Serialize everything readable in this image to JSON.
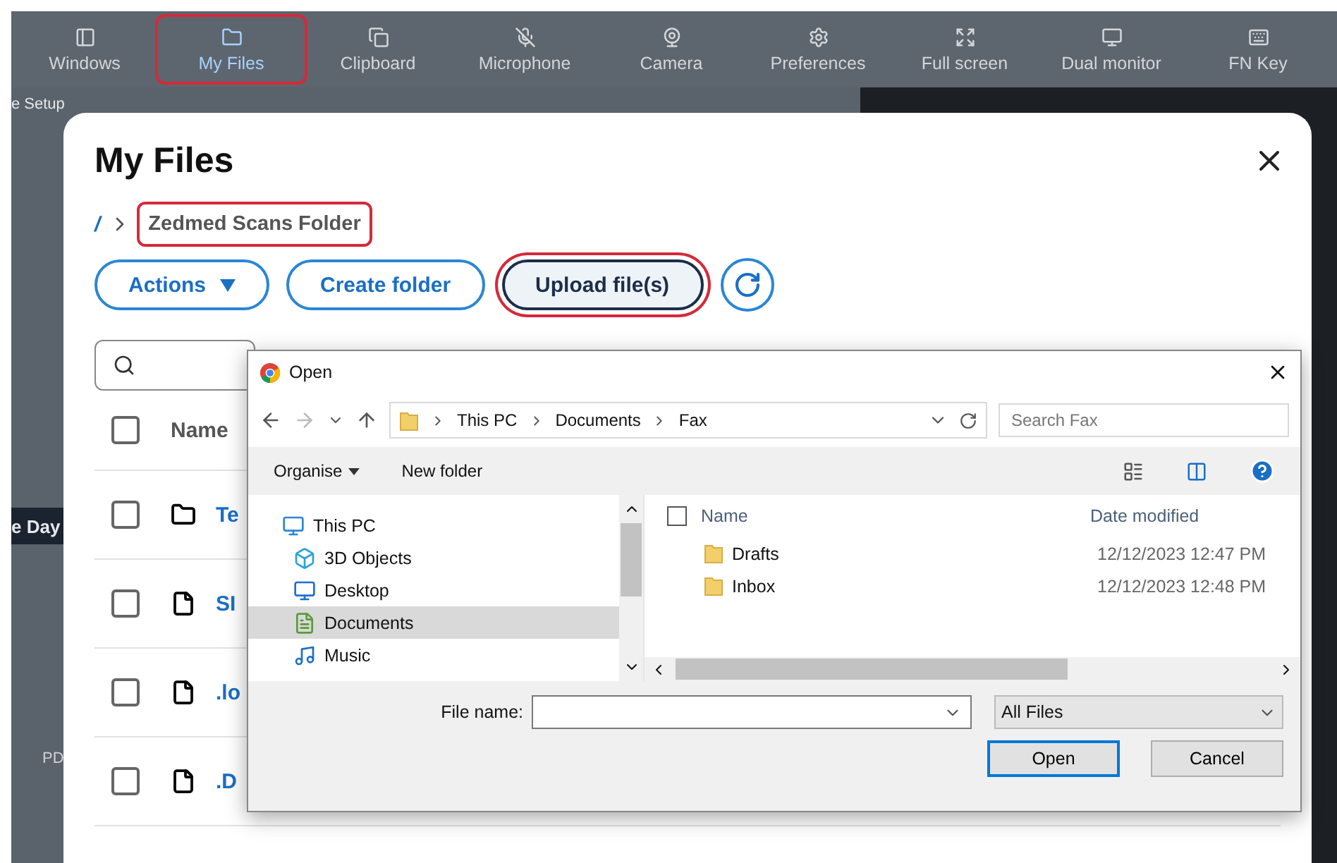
{
  "toolbar": [
    {
      "label": "Windows",
      "kind": "panel",
      "selected": false,
      "highlighted": false
    },
    {
      "label": "My Files",
      "kind": "folder",
      "selected": true,
      "highlighted": true
    },
    {
      "label": "Clipboard",
      "kind": "copy",
      "selected": false,
      "highlighted": false
    },
    {
      "label": "Microphone",
      "kind": "mic",
      "selected": false,
      "highlighted": false
    },
    {
      "label": "Camera",
      "kind": "camera",
      "selected": false,
      "highlighted": false
    },
    {
      "label": "Preferences",
      "kind": "gear",
      "selected": false,
      "highlighted": false
    },
    {
      "label": "Full screen",
      "kind": "expand",
      "selected": false,
      "highlighted": false
    },
    {
      "label": "Dual monitor",
      "kind": "monitors",
      "selected": false,
      "highlighted": false
    },
    {
      "label": "FN Key",
      "kind": "keyboard",
      "selected": false,
      "highlighted": false
    }
  ],
  "background": {
    "menu": "e Setup",
    "banner": "e Day",
    "footer": "PD"
  },
  "modal": {
    "title": "My Files",
    "breadcrumb": {
      "root": "/",
      "current": "Zedmed Scans Folder",
      "highlighted": true
    },
    "buttons": [
      {
        "label": "Actions",
        "kind": "dropdown",
        "highlighted": false
      },
      {
        "label": "Create folder",
        "kind": "plain",
        "highlighted": false
      },
      {
        "label": "Upload file(s)",
        "kind": "plain",
        "highlighted": true
      },
      {
        "kind": "refresh",
        "highlighted": false
      }
    ],
    "table": {
      "header": "Name",
      "checked": false,
      "rows": [
        {
          "kind": "folder",
          "name": "Te",
          "checked": false
        },
        {
          "kind": "file",
          "name": "SI",
          "checked": false
        },
        {
          "kind": "file",
          "name": ".lo",
          "checked": false
        },
        {
          "kind": "file",
          "name": ".D",
          "checked": false
        }
      ]
    }
  },
  "dialog": {
    "title": "Open",
    "path": [
      "This PC",
      "Documents",
      "Fax"
    ],
    "search": {
      "placeholder": "Search Fax"
    },
    "commands": [
      "Organise",
      "New folder"
    ],
    "nav": [
      {
        "label": "This PC",
        "kind": "pc",
        "selected": false,
        "children": [
          {
            "label": "3D Objects",
            "kind": "cube",
            "selected": false
          },
          {
            "label": "Desktop",
            "kind": "desktop",
            "selected": false
          },
          {
            "label": "Documents",
            "kind": "documents",
            "selected": true
          },
          {
            "label": "Music",
            "kind": "music",
            "selected": false
          }
        ]
      }
    ],
    "columns": [
      "Name",
      "Date modified"
    ],
    "select_all_checked": false,
    "files": [
      {
        "name": "Drafts",
        "date": "12/12/2023 12:47 PM"
      },
      {
        "name": "Inbox",
        "date": "12/12/2023 12:48 PM"
      }
    ],
    "file_name": {
      "label": "File name:"
    },
    "filter": "All Files",
    "buttons": [
      {
        "label": "Open",
        "kind": "primary"
      },
      {
        "label": "Cancel",
        "kind": "secondary"
      }
    ]
  }
}
